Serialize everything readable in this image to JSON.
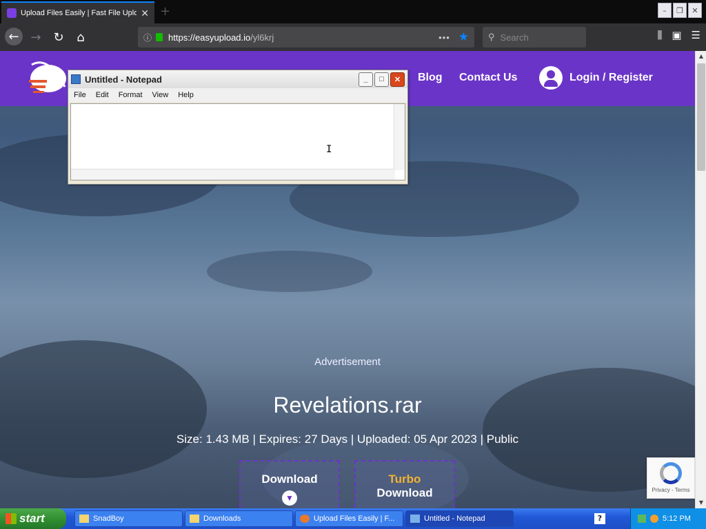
{
  "browser": {
    "tab_title": "Upload Files Easily | Fast File Uplo",
    "url_domain": "https://easyupload.io",
    "url_path": "/yl6krj",
    "search_placeholder": "Search"
  },
  "site": {
    "nav": {
      "blog": "Blog",
      "contact": "Contact Us",
      "login": "Login / Register"
    },
    "advertisement": "Advertisement",
    "file_name": "Revelations.rar",
    "file_meta": "Size: 1.43 MB | Expires: 27 Days | Uploaded: 05 Apr 2023 | Public",
    "download_label": "Download",
    "turbo_label": "Turbo",
    "turbo_download_label": "Download",
    "recaptcha_text": "Privacy - Terms",
    "brand_color": "#6a34c8",
    "turbo_color": "#f2b233"
  },
  "notepad": {
    "title": "Untitled - Notepad",
    "menu": [
      "File",
      "Edit",
      "Format",
      "View",
      "Help"
    ]
  },
  "taskbar": {
    "start": "start",
    "tasks": [
      "SnadBoy",
      "Downloads",
      "Upload Files Easily | F...",
      "Untitled - Notepad"
    ],
    "clock": "5:12 PM"
  }
}
